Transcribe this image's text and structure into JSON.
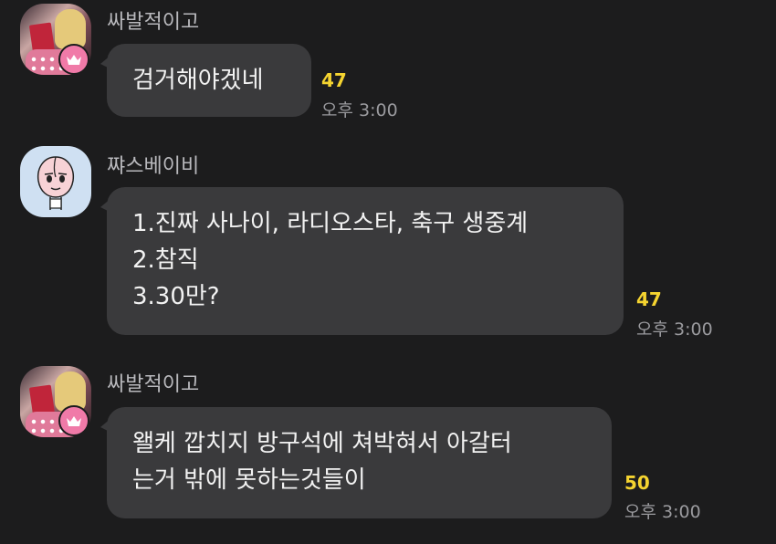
{
  "messages": [
    {
      "sender": "싸발적이고",
      "avatar": "profile-photo",
      "badge_icon": "crown-icon",
      "lines": [
        "검거해야겠네"
      ],
      "unread_count": "47",
      "time": "오후 3:00"
    },
    {
      "sender": "쨔스베이비",
      "avatar": "peach-character",
      "lines": [
        "1.진짜 사나이, 라디오스타, 축구 생중계",
        "2.참직",
        "3.30만?"
      ],
      "unread_count": "47",
      "time": "오후 3:00"
    },
    {
      "sender": "싸발적이고",
      "avatar": "profile-photo",
      "badge_icon": "crown-icon",
      "lines": [
        "왤케 깝치지 방구석에 쳐박혀서 아갈터",
        "는거 밖에 못하는것들이"
      ],
      "unread_count": "50",
      "time": "오후 3:00"
    }
  ],
  "colors": {
    "background": "#1c1c1d",
    "bubble": "#3a3a3c",
    "unread_count": "#f5d430",
    "badge": "#f07aa8"
  }
}
